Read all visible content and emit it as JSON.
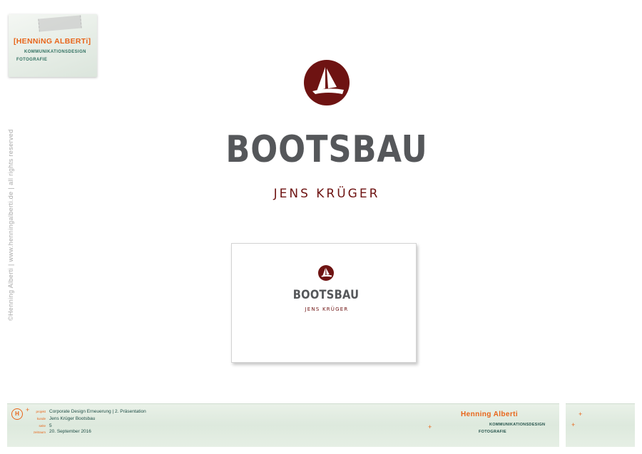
{
  "note": {
    "name": "HENNiNG ALBERTi",
    "line1": "KOMMUNIKATIONSDESIGN",
    "line2": "FOTOGRAFIE"
  },
  "vertical_credit": "©Henning Alberti  |  www.henningalberti.de  |  all rights reserved",
  "logo": {
    "title": "BOOTSBAU",
    "subtitle": "JENS KRÜGER",
    "color_title": "#55575a",
    "color_brand": "#6e1312"
  },
  "card": {
    "title": "BOOTSBAU",
    "subtitle": "JENS KRÜGER"
  },
  "footer": {
    "icon_letter": "H",
    "rows": [
      {
        "label": "projekt",
        "value": "Corporate Design Erneuerung  |  2. Präsentation"
      },
      {
        "label": "kunde",
        "value": "Jens Krüger Bootsbau"
      },
      {
        "label": "seite",
        "value": "5"
      },
      {
        "label": "zeitraum",
        "value": "20. September 2016"
      }
    ],
    "brand": "Henning Alberti",
    "line1": "KOMMUNIKATIONSDESIGN",
    "line2": "FOTOGRAFIE",
    "accent_color": "#e8651a"
  }
}
